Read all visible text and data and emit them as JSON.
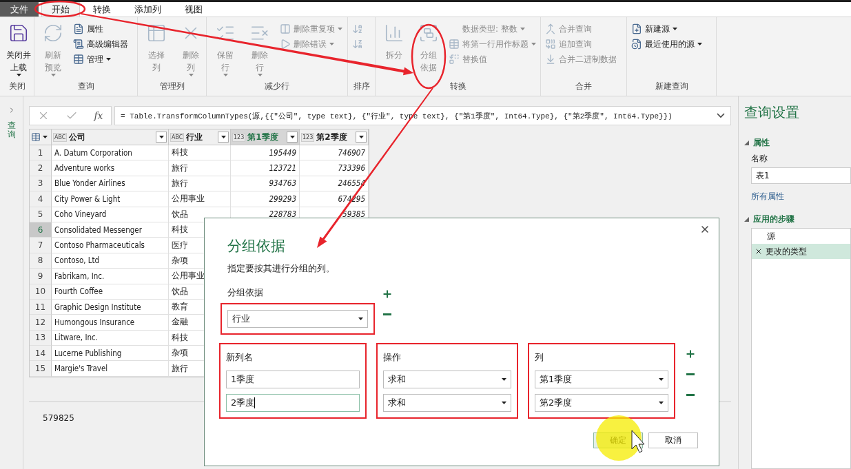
{
  "menu_tabs": [
    {
      "label": "文件",
      "kind": "file",
      "selected": false
    },
    {
      "label": "开始",
      "kind": "tab",
      "selected": true
    },
    {
      "label": "转换",
      "kind": "tab",
      "selected": false
    },
    {
      "label": "添加列",
      "kind": "tab",
      "selected": false
    },
    {
      "label": "视图",
      "kind": "tab",
      "selected": false
    }
  ],
  "ribbon": {
    "groups": [
      {
        "label": "关闭",
        "items": [
          {
            "kind": "large",
            "lines": [
              "关闭并",
              "上载"
            ],
            "dropdown": true,
            "disabled": false
          }
        ]
      },
      {
        "label": "查询",
        "items": [
          {
            "kind": "large",
            "lines": [
              "刷新",
              "预览"
            ],
            "dropdown": true,
            "disabled": true
          },
          {
            "kind": "small",
            "label": "属性",
            "dropdown": false,
            "disabled": false
          },
          {
            "kind": "small",
            "label": "高级编辑器",
            "dropdown": false,
            "disabled": false
          },
          {
            "kind": "small",
            "label": "管理",
            "dropdown": true,
            "disabled": false
          }
        ]
      },
      {
        "label": "管理列",
        "items": [
          {
            "kind": "large",
            "lines": [
              "选择",
              "列"
            ],
            "dropdown": false,
            "disabled": true
          },
          {
            "kind": "large",
            "lines": [
              "删除",
              "列"
            ],
            "dropdown": true,
            "disabled": true
          }
        ]
      },
      {
        "label": "减少行",
        "items": [
          {
            "kind": "large",
            "lines": [
              "保留",
              "行"
            ],
            "dropdown": true,
            "disabled": true
          },
          {
            "kind": "large",
            "lines": [
              "删除",
              "行"
            ],
            "dropdown": true,
            "disabled": true
          },
          {
            "kind": "small",
            "label": "删除重复项",
            "dropdown": true,
            "disabled": true
          },
          {
            "kind": "small",
            "label": "删除错误",
            "dropdown": true,
            "disabled": true
          }
        ]
      },
      {
        "label": "排序",
        "items": [
          {
            "kind": "icon",
            "disabled": true
          },
          {
            "kind": "icon",
            "disabled": true
          }
        ]
      },
      {
        "label": "转换",
        "items": [
          {
            "kind": "large",
            "lines": [
              "拆分"
            ],
            "dropdown": false,
            "disabled": true
          },
          {
            "kind": "large",
            "lines": [
              "分组",
              "依据"
            ],
            "dropdown": false,
            "disabled": true
          },
          {
            "kind": "small",
            "label": "数据类型: 整数",
            "dropdown": true,
            "disabled": true
          },
          {
            "kind": "small",
            "label": "将第一行用作标题",
            "dropdown": true,
            "disabled": true
          },
          {
            "kind": "small",
            "label": "替换值",
            "dropdown": false,
            "disabled": true
          }
        ]
      },
      {
        "label": "合并",
        "items": [
          {
            "kind": "small",
            "label": "合并查询",
            "dropdown": false,
            "disabled": true
          },
          {
            "kind": "small",
            "label": "追加查询",
            "dropdown": false,
            "disabled": true
          },
          {
            "kind": "small",
            "label": "合并二进制数据",
            "dropdown": false,
            "disabled": true
          }
        ]
      },
      {
        "label": "新建查询",
        "items": [
          {
            "kind": "small",
            "label": "新建源",
            "dropdown": true,
            "disabled": false
          },
          {
            "kind": "small",
            "label": "最近使用的源",
            "dropdown": true,
            "disabled": false
          }
        ]
      }
    ]
  },
  "queries_pane": {
    "label": "查询"
  },
  "formula_buttons": {
    "function_label": "fx"
  },
  "formula": "= Table.TransformColumnTypes(源,{{\"公司\", type text}, {\"行业\", type text}, {\"第1季度\", Int64.Type}, {\"第2季度\", Int64.Type}})",
  "table": {
    "columns": [
      {
        "type": "ABC",
        "name": "公司",
        "kind": "text",
        "selected": false
      },
      {
        "type": "ABC",
        "name": "行业",
        "kind": "text",
        "selected": false
      },
      {
        "type": "123",
        "name": "第1季度",
        "kind": "number",
        "selected": true
      },
      {
        "type": "123",
        "name": "第2季度",
        "kind": "number",
        "selected": false
      }
    ],
    "rows": [
      {
        "index": "1",
        "cells": [
          "A. Datum Corporation",
          "科技",
          "195449",
          "746907"
        ],
        "selected": false
      },
      {
        "index": "2",
        "cells": [
          "Adventure works",
          "旅行",
          "123721",
          "733396"
        ],
        "selected": false
      },
      {
        "index": "3",
        "cells": [
          "Blue Yonder Airlines",
          "旅行",
          "934763",
          "246554"
        ],
        "selected": false
      },
      {
        "index": "4",
        "cells": [
          "City Power & Light",
          "公用事业",
          "299293",
          "674295"
        ],
        "selected": false
      },
      {
        "index": "5",
        "cells": [
          "Coho Vineyard",
          "饮品",
          "228783",
          "59385"
        ],
        "selected": false
      },
      {
        "index": "6",
        "cells": [
          "Consolidated Messenger",
          "科技"
        ],
        "selected": true
      },
      {
        "index": "7",
        "cells": [
          "Contoso Pharmaceuticals",
          "医疗"
        ],
        "selected": false
      },
      {
        "index": "8",
        "cells": [
          "Contoso, Ltd",
          "杂项"
        ],
        "selected": false
      },
      {
        "index": "9",
        "cells": [
          "Fabrikam, Inc.",
          "公用事业"
        ],
        "selected": false
      },
      {
        "index": "10",
        "cells": [
          "Fourth Coffee",
          "饮品"
        ],
        "selected": false
      },
      {
        "index": "11",
        "cells": [
          "Graphic Design Institute",
          "教育"
        ],
        "selected": false
      },
      {
        "index": "12",
        "cells": [
          "Humongous Insurance",
          "金融"
        ],
        "selected": false
      },
      {
        "index": "13",
        "cells": [
          "Litware, Inc.",
          "科技"
        ],
        "selected": false
      },
      {
        "index": "14",
        "cells": [
          "Lucerne Publishing",
          "杂项"
        ],
        "selected": false
      },
      {
        "index": "15",
        "cells": [
          "Margie's Travel",
          "旅行"
        ],
        "selected": false
      }
    ]
  },
  "status_value": "579825",
  "query_settings": {
    "title": "查询设置",
    "properties": {
      "label": "属性",
      "expanded": true,
      "name_label": "名称",
      "name_value": "表1",
      "link": "所有属性"
    },
    "steps": {
      "label": "应用的步骤",
      "expanded": true,
      "items": [
        {
          "label": "源",
          "selected": false
        },
        {
          "label": "更改的类型",
          "selected": true
        }
      ]
    }
  },
  "dialog": {
    "title": "分组依据",
    "description": "指定要按其进行分组的列。",
    "group_label": "分组依据",
    "group_value": "行业",
    "headers": [
      "新列名",
      "操作",
      "列"
    ],
    "aggregations": [
      {
        "name": "1季度",
        "operation": "求和",
        "column": "第1季度",
        "focused": false
      },
      {
        "name": "2季度",
        "operation": "求和",
        "column": "第2季度",
        "focused": true
      }
    ],
    "buttons": [
      {
        "label": "确定",
        "kind": "primary"
      },
      {
        "label": "取消",
        "kind": "secondary"
      }
    ]
  }
}
